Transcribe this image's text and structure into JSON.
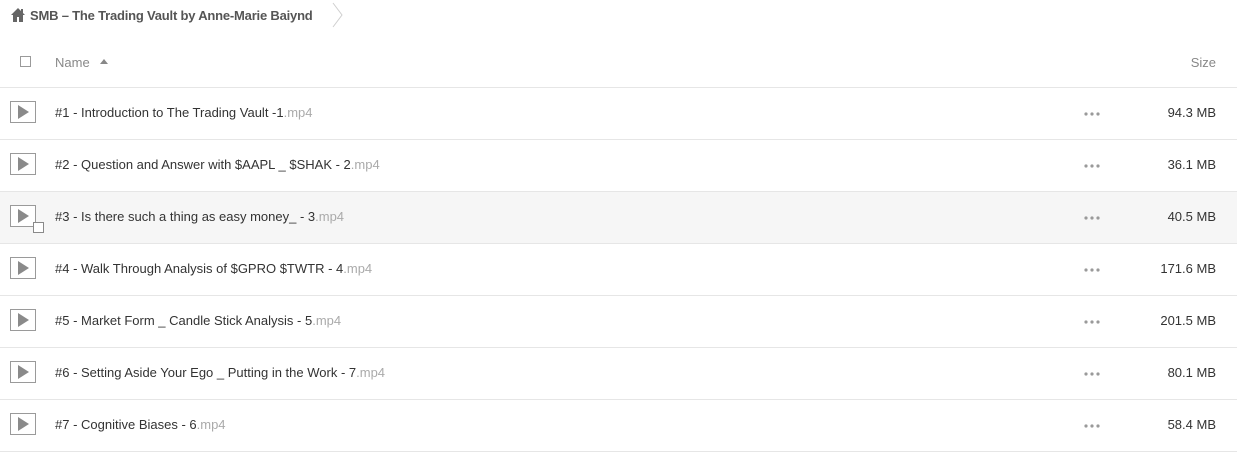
{
  "breadcrumb": {
    "title": "SMB – The Trading Vault by Anne-Marie Baiynd",
    "home_icon": "home-icon",
    "separator_icon": "chevron-right-icon"
  },
  "header": {
    "name_label": "Name",
    "size_label": "Size",
    "sort_direction": "ascending"
  },
  "files": [
    {
      "name": "#1 - Introduction to The Trading Vault -1",
      "ext": ".mp4",
      "size": "94.3 MB"
    },
    {
      "name": "#2 - Question and Answer with $AAPL _ $SHAK - 2",
      "ext": ".mp4",
      "size": "36.1 MB"
    },
    {
      "name": "#3 - Is there such a thing as easy money_ - 3",
      "ext": ".mp4",
      "size": "40.5 MB",
      "hovered": true
    },
    {
      "name": "#4 - Walk Through Analysis of $GPRO $TWTR - 4",
      "ext": ".mp4",
      "size": "171.6 MB"
    },
    {
      "name": "#5 - Market Form _ Candle Stick Analysis - 5",
      "ext": ".mp4",
      "size": "201.5 MB"
    },
    {
      "name": "#6 - Setting Aside Your Ego _ Putting in the Work - 7",
      "ext": ".mp4",
      "size": "80.1 MB"
    },
    {
      "name": "#7 - Cognitive Biases - 6",
      "ext": ".mp4",
      "size": "58.4 MB"
    }
  ],
  "icons": {
    "file_icon": "play-icon",
    "actions_icon": "more-options-icon"
  },
  "colors": {
    "text": "#333333",
    "muted": "#888888",
    "extension": "#aaaaaa",
    "row_hover": "#f6f6f6",
    "divider": "#e6e6e6"
  }
}
